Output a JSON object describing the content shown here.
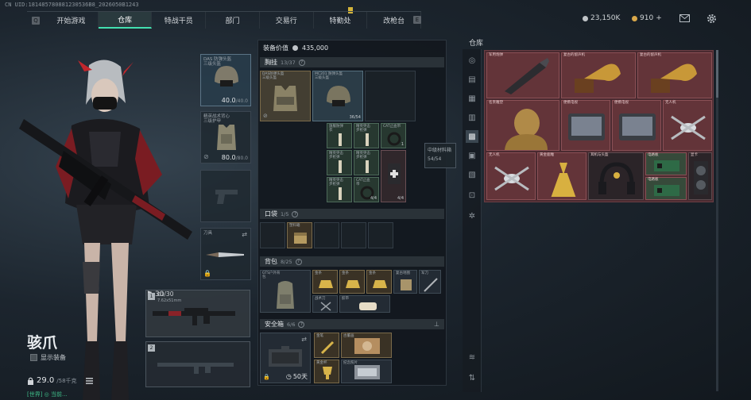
{
  "uid_text": "CN UID:181485780881230536B8_2026050B1243",
  "nav": {
    "left_key": "Q",
    "right_key": "E",
    "tabs": [
      {
        "label": "开始游戏",
        "active": false
      },
      {
        "label": "仓库",
        "active": true
      },
      {
        "label": "特战干员",
        "active": false
      },
      {
        "label": "部门",
        "active": false
      },
      {
        "label": "交易行",
        "active": false
      },
      {
        "label": "特勤处",
        "active": false
      },
      {
        "label": "改枪台",
        "active": false
      }
    ]
  },
  "currency": {
    "coins": "23,150K",
    "tickets": "910",
    "tickets_plus": "+",
    "coin_color": "#c0c4c8",
    "ticket_color": "#d9a84a"
  },
  "top_icons": [
    "mail-icon",
    "settings-gear-icon"
  ],
  "character": {
    "name": "骇爪",
    "show_gear_label": "显示装备",
    "weight": "29.0",
    "weight_unit": "/58千克",
    "bottom_tip": "[世界] ◎ 当前..."
  },
  "equipment": {
    "helmet": {
      "label": "DAS 防弹头盔\n三级头盔",
      "durability": "40.0",
      "max": "/40.0"
    },
    "armor": {
      "label": "精英战术背心\n三级护甲",
      "durability": "80.0",
      "max": "/80.0"
    },
    "pistol": {
      "label": ""
    },
    "melee": {
      "label": "刀具"
    },
    "primary": {
      "num": "1",
      "label": "G3",
      "sub": "7.62x51mm",
      "ammo": "30",
      "ammo_max": "/30"
    },
    "secondary": {
      "num": "2",
      "label": ""
    }
  },
  "midpanel": {
    "value_label": "装备价值",
    "value": "435,000",
    "vest": {
      "title": "胸挂",
      "count": "13",
      "max": "/37"
    },
    "pocket": {
      "title": "口袋",
      "count": "1",
      "max": "/5"
    },
    "backpack": {
      "title": "背包",
      "count": "8",
      "max": "/25"
    },
    "safebox": {
      "title": "安全箱",
      "count": "6",
      "max": "/6",
      "timer": "50天"
    },
    "vest_items": [
      {
        "label": "DAS防弹头盔\n三级头盔"
      },
      {
        "label": "MC201 防弹头盔\n三级头盔",
        "count": "36/54"
      },
      {
        "label": "精英战术背心\n三级护甲"
      },
      {
        "label": "旗舰防弹\n衣"
      },
      {
        "label": "CAT止血带",
        "count": "1"
      },
      {
        "label": "精英突击\n步枪弹"
      },
      {
        "label": "精英突击\n步枪弹"
      },
      {
        "label": "CAT止血\n带"
      },
      {
        "label": "精英突击\n步枪弹"
      },
      {
        "label": "精英突击\n步枪弹"
      },
      {
        "label": "精英突击\n步枪弹",
        "count": "4/4"
      },
      {
        "label": "CAT止血\n带",
        "count": "4/4"
      }
    ],
    "pocket_items": [
      {
        "label": "塑料箱"
      }
    ],
    "backpack_items": [
      {
        "label": "GTS户外背\n包"
      },
      {
        "label": "金条"
      },
      {
        "label": "金条"
      },
      {
        "label": "金条"
      },
      {
        "label": "复古地图"
      },
      {
        "label": "军刀"
      },
      {
        "label": "战术刀"
      },
      {
        "label": "胶带"
      }
    ],
    "safebox_items": [
      {
        "label": "手提箱"
      },
      {
        "label": "金笔"
      },
      {
        "label": "古董画"
      },
      {
        "label": "黄金杯"
      },
      {
        "label": "纪念照片"
      }
    ]
  },
  "tooltip": {
    "title": "中级材料箱",
    "count": "54/54"
  },
  "warehouse": {
    "title": "仓库",
    "items": [
      {
        "label": "军用炮弹"
      },
      {
        "label": "复古的留声机"
      },
      {
        "label": "复古的留声机"
      },
      {
        "label": "名贵雕塑"
      },
      {
        "label": "便携电视"
      },
      {
        "label": "便携电视"
      },
      {
        "label": "无人机"
      },
      {
        "label": "无人机"
      },
      {
        "label": "黄金鹿雕"
      },
      {
        "label": "耳机与头盔"
      },
      {
        "label": "电路板"
      },
      {
        "label": "电路板"
      },
      {
        "label": "显卡"
      }
    ]
  }
}
